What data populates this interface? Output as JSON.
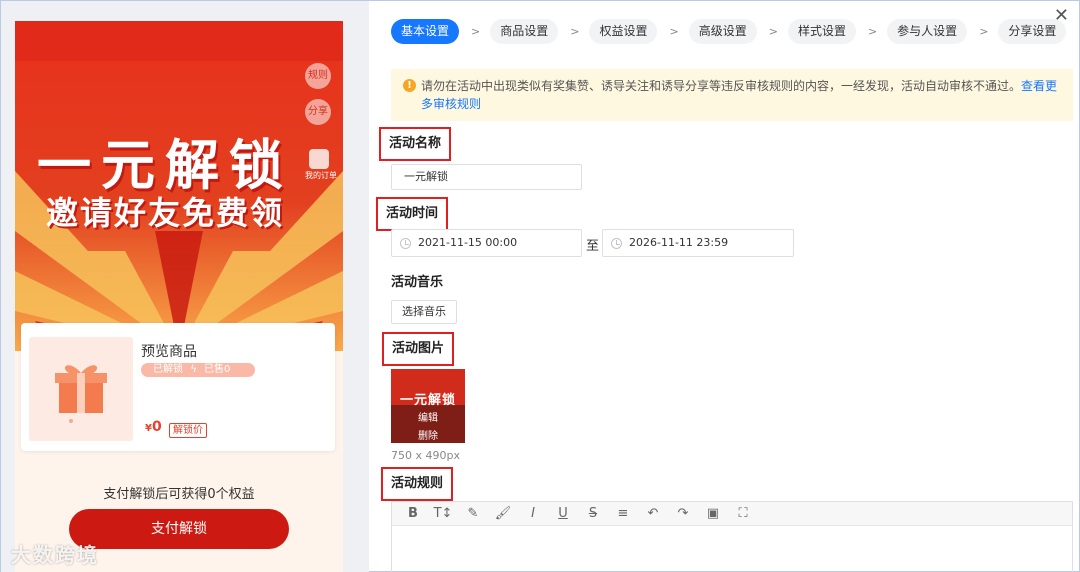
{
  "preview": {
    "rules_label": "规则",
    "share_label": "分享",
    "orders_label": "我的订单",
    "title": "一元解锁",
    "subtitle": "邀请好友免费领",
    "product": {
      "name": "预览商品",
      "unlocked": "已解锁",
      "sold": "已售0",
      "currency": "¥",
      "price": "0",
      "price_tag": "解锁价"
    },
    "benefit_text": "支付解锁后可获得0个权益",
    "pay_button": "支付解锁",
    "watermark": "大数跨境"
  },
  "steps": [
    {
      "label": "基本设置",
      "active": true
    },
    {
      "label": "商品设置"
    },
    {
      "label": "权益设置"
    },
    {
      "label": "高级设置"
    },
    {
      "label": "样式设置"
    },
    {
      "label": "参与人设置"
    },
    {
      "label": "分享设置"
    }
  ],
  "step_separator": ">",
  "close_label": "✕",
  "notice": {
    "text": "请勿在活动中出现类似有奖集赞、诱导关注和诱导分享等违反审核规则的内容，一经发现，活动自动审核不通过。",
    "link": "查看更多审核规则"
  },
  "form": {
    "name_label": "活动名称",
    "name_value": "一元解锁",
    "time_label": "活动时间",
    "start_time": "2021-11-15 00:00",
    "to_label": "至",
    "end_time": "2026-11-11 23:59",
    "music_label": "活动音乐",
    "music_button": "选择音乐",
    "image_label": "活动图片",
    "image_title": "一元解锁",
    "image_edit": "编辑",
    "image_delete": "删除",
    "image_size": "750 x 490px",
    "rules_label": "活动规则"
  },
  "editor_tools": [
    "B",
    "T↕",
    "✎",
    "🖌",
    "I",
    "U",
    "S",
    "≡",
    "↶",
    "↷",
    "▣",
    "⛶"
  ],
  "colors": {
    "accent": "#1677ff",
    "banner_red": "#d8261a",
    "pay_red": "#cc1a12",
    "highlight_box": "#e02020"
  }
}
